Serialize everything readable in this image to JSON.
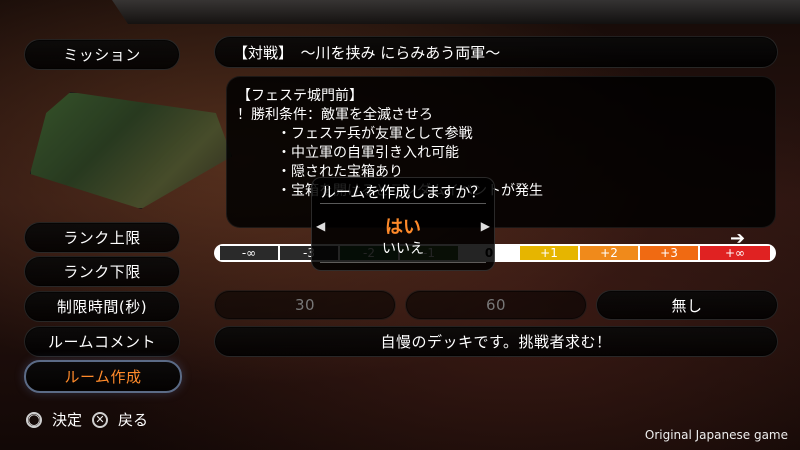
{
  "sidebar": {
    "mission": "ミッション",
    "rank_upper": "ランク上限",
    "rank_lower": "ランク下限",
    "time_limit": "制限時間(秒)",
    "room_comment": "ルームコメント",
    "create_room": "ルーム作成"
  },
  "mission": {
    "title": "【対戦】　〜川を挟み にらみあう両軍〜",
    "lines": [
      "【フェステ城門前】",
      "！勝利条件：敵軍を全滅させろ",
      "・フェステ兵が友軍として参戦",
      "・中立軍の自軍引き入れ可能",
      "・隠された宝箱あり",
      "・宝箱を開けるとランダムイベントが発生"
    ]
  },
  "rank_scale": {
    "labels": [
      "-∞",
      "-3",
      "-2",
      "-1",
      "0",
      "+1",
      "+2",
      "+3",
      "+∞"
    ],
    "colors": [
      "#2a2a2a",
      "#2a2a2a",
      "#245a2a",
      "#3f6b2b",
      "#ffffff",
      "#e6b500",
      "#f08a1b",
      "#f06a12",
      "#e02222"
    ]
  },
  "time_options": [
    "30",
    "60",
    "無し"
  ],
  "room_comment_value": "自慢のデッキです。挑戦者求む！",
  "dialog": {
    "title": "ルームを作成しますか？",
    "yes": "はい",
    "no": "いいえ"
  },
  "footer": {
    "confirm": "決定",
    "back": "戻る",
    "confirm_icon": "circle-button-icon",
    "back_icon": "cross-button-icon",
    "note": "Original Japanese game"
  }
}
